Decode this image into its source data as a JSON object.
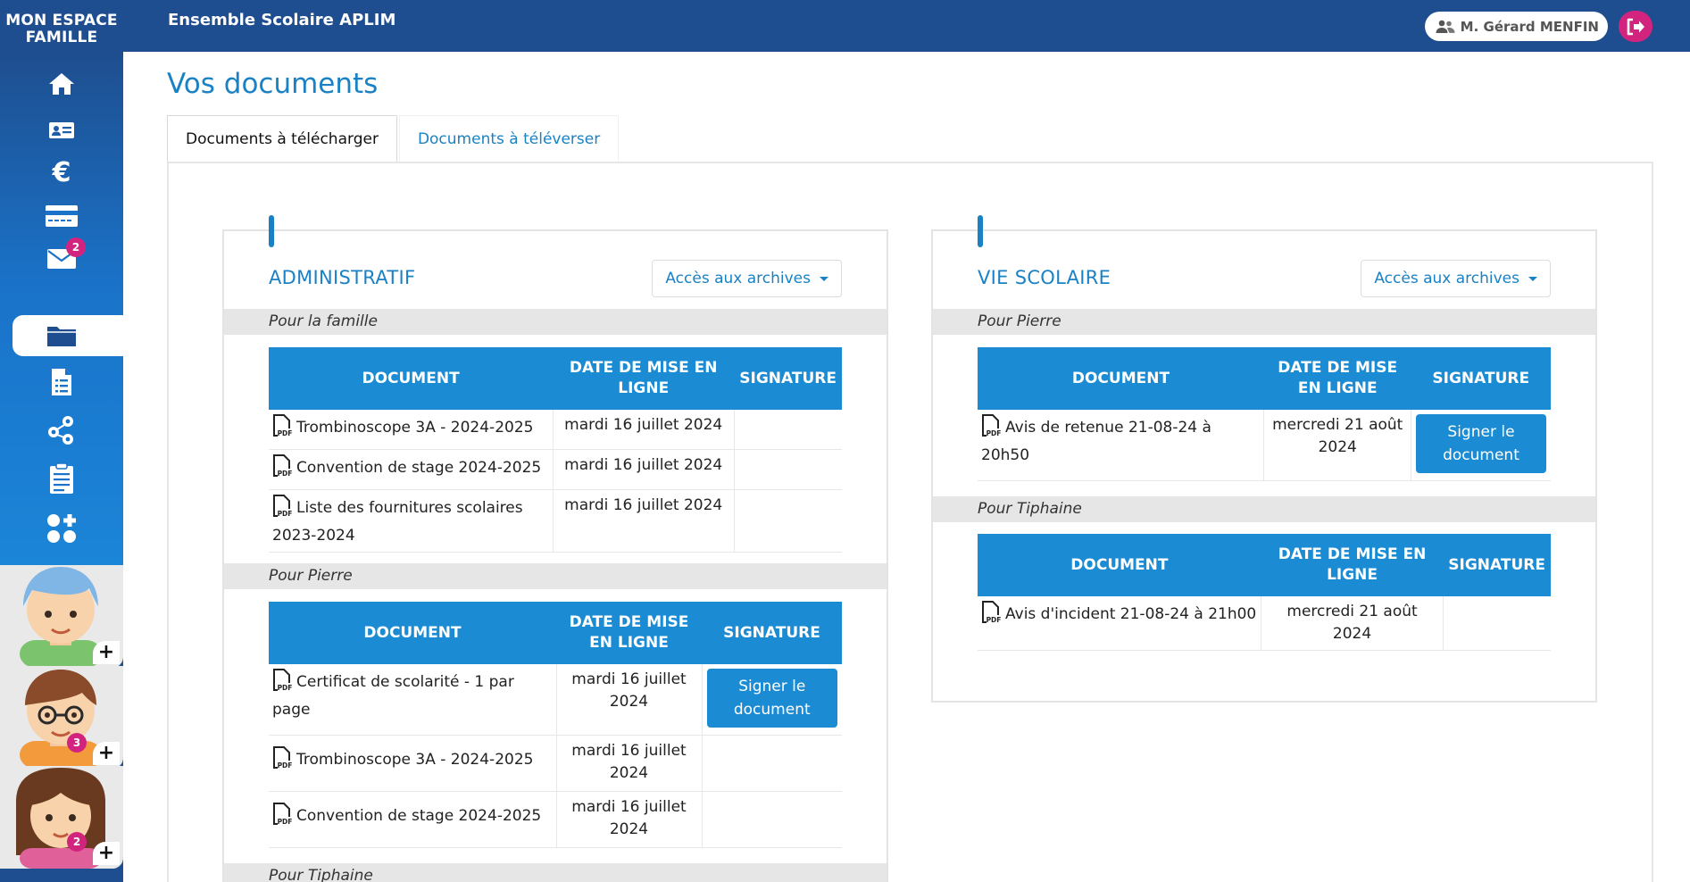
{
  "brand": {
    "line1": "MON ESPACE",
    "line2": "FAMILLE"
  },
  "header": {
    "school_name": "Ensemble Scolaire APLIM",
    "user_name": "M. Gérard MENFIN"
  },
  "sidebar": {
    "items": [
      {
        "icon": "home-icon"
      },
      {
        "icon": "id-card-icon"
      },
      {
        "icon": "euro-icon"
      },
      {
        "icon": "credit-card-icon"
      },
      {
        "icon": "mail-icon",
        "badge": "2"
      },
      {
        "icon": "folder-icon",
        "active": true
      },
      {
        "icon": "document-icon"
      },
      {
        "icon": "group-icon"
      },
      {
        "icon": "clipboard-icon"
      },
      {
        "icon": "apps-plus-icon"
      }
    ],
    "children": [
      {
        "badge": ""
      },
      {
        "badge": "3"
      },
      {
        "badge": "2"
      }
    ]
  },
  "page": {
    "title": "Vos documents"
  },
  "tabs": [
    {
      "label": "Documents à télécharger",
      "active": true
    },
    {
      "label": "Documents à téléverser",
      "active": false
    }
  ],
  "columns": {
    "document": "DOCUMENT",
    "date": "DATE DE MISE EN LIGNE",
    "signature": "SIGNATURE"
  },
  "sign_label": "Signer le document",
  "admin": {
    "title": "ADMINISTRATIF",
    "archives": "Accès aux archives",
    "groups": [
      {
        "label": "Pour la famille",
        "rows": [
          {
            "doc": "Trombinoscope 3A - 2024-2025",
            "date": "mardi 16 juillet 2024",
            "sign": false
          },
          {
            "doc": "Convention de stage 2024-2025",
            "date": "mardi 16 juillet 2024",
            "sign": false
          },
          {
            "doc": "Liste des fournitures scolaires 2023-2024",
            "date": "mardi 16 juillet 2024",
            "sign": false
          }
        ]
      },
      {
        "label": "Pour Pierre",
        "rows": [
          {
            "doc": "Certificat de scolarité - 1 par page",
            "date": "mardi 16 juillet 2024",
            "sign": true
          },
          {
            "doc": "Trombinoscope 3A - 2024-2025",
            "date": "mardi 16 juillet 2024",
            "sign": false
          },
          {
            "doc": "Convention de stage 2024-2025",
            "date": "mardi 16 juillet 2024",
            "sign": false
          }
        ]
      },
      {
        "label": "Pour Tiphaine",
        "rows": []
      }
    ]
  },
  "vie": {
    "title": "VIE SCOLAIRE",
    "archives": "Accès aux archives",
    "groups": [
      {
        "label": "Pour Pierre",
        "rows": [
          {
            "doc": "Avis de retenue 21-08-24 à 20h50",
            "date": "mercredi 21 août 2024",
            "sign": true
          }
        ]
      },
      {
        "label": "Pour Tiphaine",
        "rows": [
          {
            "doc": "Avis d'incident 21-08-24 à 21h00",
            "date": "mercredi 21 août 2024",
            "sign": false
          }
        ]
      }
    ]
  }
}
